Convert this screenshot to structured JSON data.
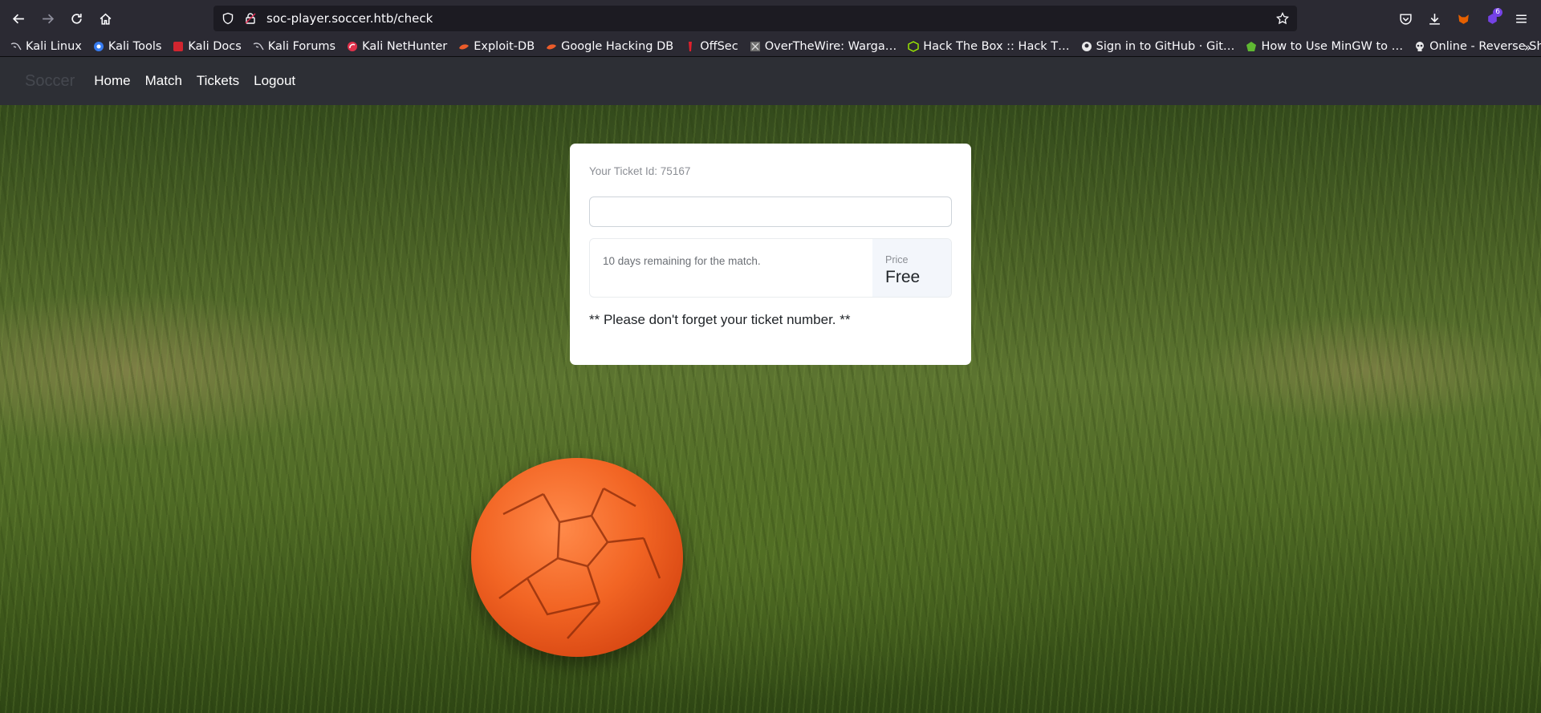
{
  "browser": {
    "url": "soc-player.soccer.htb/check",
    "extension_badge": "6",
    "bookmarks": [
      {
        "label": "Kali Linux",
        "icon": "kali-dragon-icon"
      },
      {
        "label": "Kali Tools",
        "icon": "kali-tools-icon"
      },
      {
        "label": "Kali Docs",
        "icon": "kali-docs-icon"
      },
      {
        "label": "Kali Forums",
        "icon": "kali-dragon-icon"
      },
      {
        "label": "Kali NetHunter",
        "icon": "nethunter-icon"
      },
      {
        "label": "Exploit-DB",
        "icon": "exploitdb-icon"
      },
      {
        "label": "Google Hacking DB",
        "icon": "exploitdb-icon"
      },
      {
        "label": "OffSec",
        "icon": "offsec-icon"
      },
      {
        "label": "OverTheWire: Warga…",
        "icon": "overthewire-icon"
      },
      {
        "label": "Hack The Box :: Hack T…",
        "icon": "htb-cube-icon"
      },
      {
        "label": "Sign in to GitHub · Git…",
        "icon": "github-icon"
      },
      {
        "label": "How to Use MinGW to …",
        "icon": "mingw-icon"
      },
      {
        "label": "Online - Reverse Shell …",
        "icon": "skull-icon"
      }
    ]
  },
  "site": {
    "brand": "Soccer",
    "nav": [
      "Home",
      "Match",
      "Tickets",
      "Logout"
    ]
  },
  "card": {
    "ticket_label": "Your Ticket Id: 75167",
    "input_value": "",
    "remaining_text": "10 days remaining for the match.",
    "price_label": "Price",
    "price_value": "Free",
    "reminder": "** Please don't forget your ticket number. **"
  },
  "colors": {
    "ball": "#f26524",
    "nav_bg": "#2d2f35",
    "chrome_bg": "#2b2a33"
  }
}
